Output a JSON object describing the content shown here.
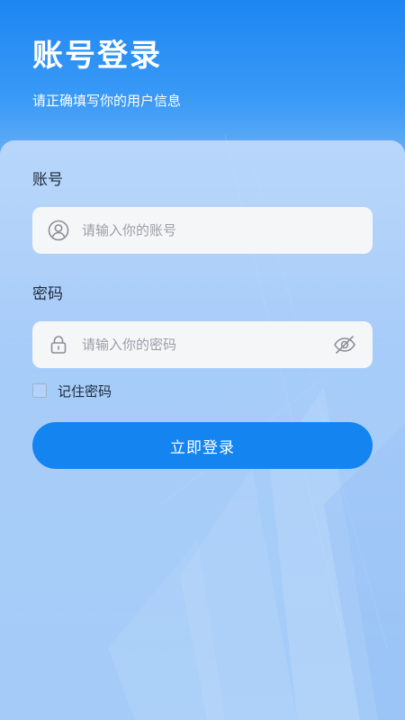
{
  "header": {
    "title": "账号登录",
    "subtitle": "请正确填写你的用户信息"
  },
  "form": {
    "account": {
      "label": "账号",
      "placeholder": "请输入你的账号",
      "value": "",
      "icon": "user-circle-icon"
    },
    "password": {
      "label": "密码",
      "placeholder": "请输入你的密码",
      "value": "",
      "icon": "lock-icon",
      "toggle_icon": "eye-off-icon"
    },
    "remember": {
      "label": "记住密码",
      "checked": false
    },
    "submit_label": "立即登录"
  },
  "colors": {
    "primary": "#1484f0",
    "header_top": "#1e86f2",
    "input_bg": "#f5f6f8",
    "placeholder": "#9a9fa8"
  }
}
